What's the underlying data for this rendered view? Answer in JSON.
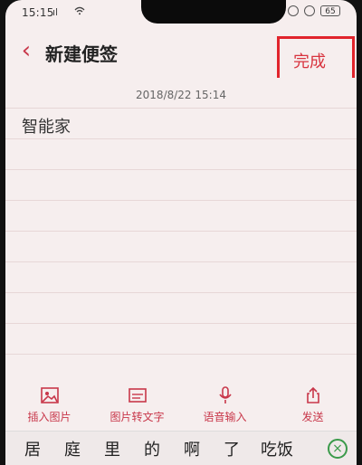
{
  "status_bar": {
    "time": "15:15",
    "signal": "ıl",
    "battery": "65"
  },
  "header": {
    "title": "新建便签",
    "done_label": "完成",
    "accent": "#c8374a"
  },
  "note": {
    "date": "2018/8/22 15:14",
    "text": "智能家"
  },
  "toolbar": {
    "items": [
      {
        "label": "插入图片",
        "icon": "image-icon"
      },
      {
        "label": "图片转文字",
        "icon": "ocr-icon"
      },
      {
        "label": "语音输入",
        "icon": "mic-icon"
      },
      {
        "label": "发送",
        "icon": "share-icon"
      }
    ]
  },
  "keyboard": {
    "candidates": [
      "居",
      "庭",
      "里",
      "的",
      "啊",
      "了",
      "吃饭"
    ]
  }
}
